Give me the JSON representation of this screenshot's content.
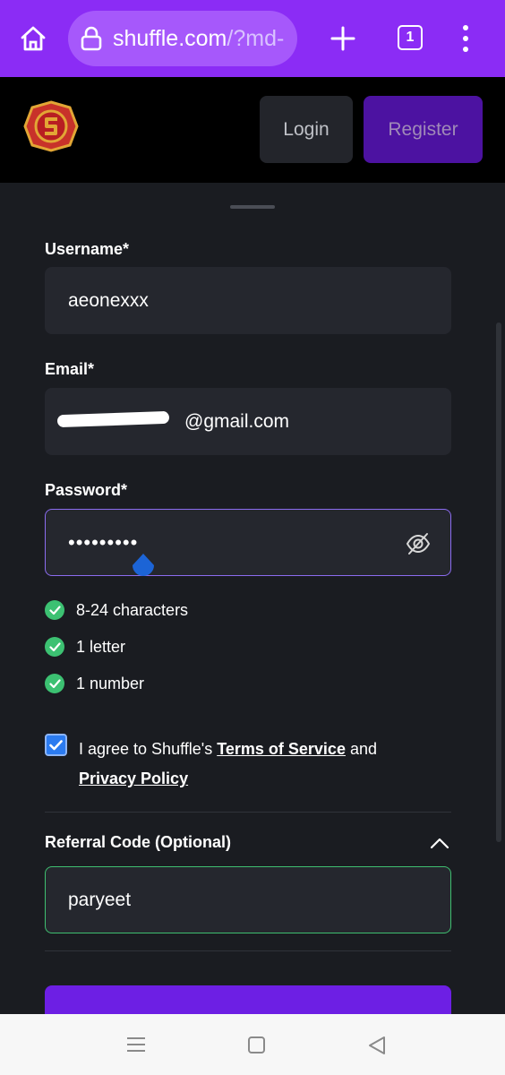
{
  "browser": {
    "url_main": "shuffle.com",
    "url_rest": "/?md-",
    "tab_count": "1"
  },
  "header": {
    "login_label": "Login",
    "register_label": "Register"
  },
  "form": {
    "username": {
      "label": "Username*",
      "value": "aeonexxx"
    },
    "email": {
      "label": "Email*",
      "visible_suffix": "@gmail.com"
    },
    "password": {
      "label": "Password*",
      "masked_value": "•••••••••"
    },
    "requirements": [
      {
        "text": "8-24 characters",
        "met": true
      },
      {
        "text": "1 letter",
        "met": true
      },
      {
        "text": "1 number",
        "met": true
      }
    ],
    "agree": {
      "prefix": "I agree to Shuffle's ",
      "terms_link": "Terms of Service",
      "middle": " and",
      "privacy_link": "Privacy Policy",
      "checked": true
    },
    "referral": {
      "label": "Referral Code (Optional)",
      "value": "paryeet"
    }
  },
  "colors": {
    "browser_bar": "#8b2cf5",
    "register_button": "#4c12a1",
    "valid_green": "#3cc172",
    "focus_border": "#8b6cf0",
    "checkbox_blue": "#2b7bf0",
    "submit_purple": "#6d1fe4"
  },
  "icons": [
    "home-icon",
    "lock-icon",
    "plus-icon",
    "tab-count-icon",
    "more-vert-icon",
    "shuffle-logo",
    "eye-off-icon",
    "check-circle-icon",
    "checkbox-icon",
    "chevron-up-icon",
    "recents-icon",
    "home-nav-icon",
    "back-icon"
  ]
}
